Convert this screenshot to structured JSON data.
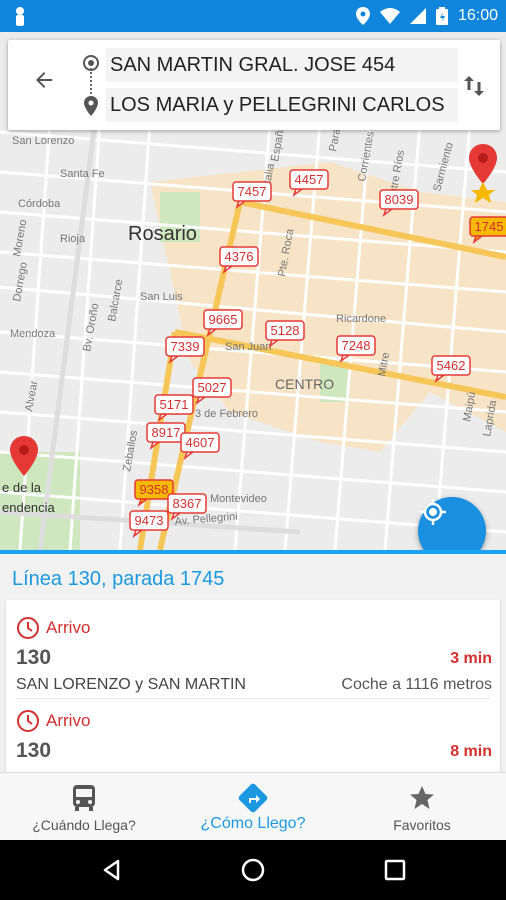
{
  "status_bar": {
    "time": "16:00",
    "icons": [
      "person-icon",
      "location-icon",
      "wifi-icon",
      "signal-icon",
      "battery-icon"
    ]
  },
  "search": {
    "origin": "SAN MARTIN GRAL. JOSE 454",
    "destination": "LOS MARIA y PELLEGRINI CARLOS"
  },
  "map": {
    "city_label": "Rosario",
    "district_label": "CENTRO",
    "street_labels": [
      "San Lorenzo",
      "Santa Fe",
      "Córdoba",
      "Rioja",
      "Sarmiento",
      "San Luis",
      "San Juan",
      "Mendoza",
      "Alvear",
      "Bv. Oroño",
      "Balcarce",
      "Ricardone",
      "Mitre",
      "Montevideo",
      "Zeballos",
      "3 de Febrero",
      "Av. Pellegrini",
      "Pte. Roca",
      "Corrientes",
      "Entre Ríos",
      "Maipú",
      "Laprida",
      "Moreno",
      "Dorrego",
      "Italia",
      "España",
      "Paraguay"
    ],
    "park_label_fragment": "de la\nendencia",
    "stop_markers": [
      "7457",
      "4457",
      "8039",
      "1745",
      "4376",
      "9665",
      "5128",
      "7339",
      "7248",
      "5462",
      "5027",
      "5171",
      "8917",
      "4607",
      "9358",
      "8367",
      "9473"
    ],
    "highlighted_stops": [
      "1745",
      "9358"
    ]
  },
  "panel": {
    "title": "Línea 130, parada 1745",
    "arrivals": [
      {
        "label": "Arrivo",
        "line": "130",
        "eta": "3 min",
        "stop": "SAN LORENZO y SAN MARTIN",
        "distance": "Coche a 1116 metros"
      },
      {
        "label": "Arrivo",
        "line": "130",
        "eta": "8 min"
      }
    ]
  },
  "bottom_nav": {
    "items": [
      {
        "label": "¿Cuándo Llega?",
        "icon": "bus-icon"
      },
      {
        "label": "¿Cómo Llego?",
        "icon": "directions-icon"
      },
      {
        "label": "Favoritos",
        "icon": "star-icon"
      }
    ]
  },
  "colors": {
    "primary": "#0f86db",
    "accent_blue": "#1b98e0",
    "alert_red": "#d32f2f",
    "marker_red": "#e53935",
    "marker_star": "#f6b900",
    "road_main": "#f6c758",
    "district_fill": "#f6e3c5"
  }
}
